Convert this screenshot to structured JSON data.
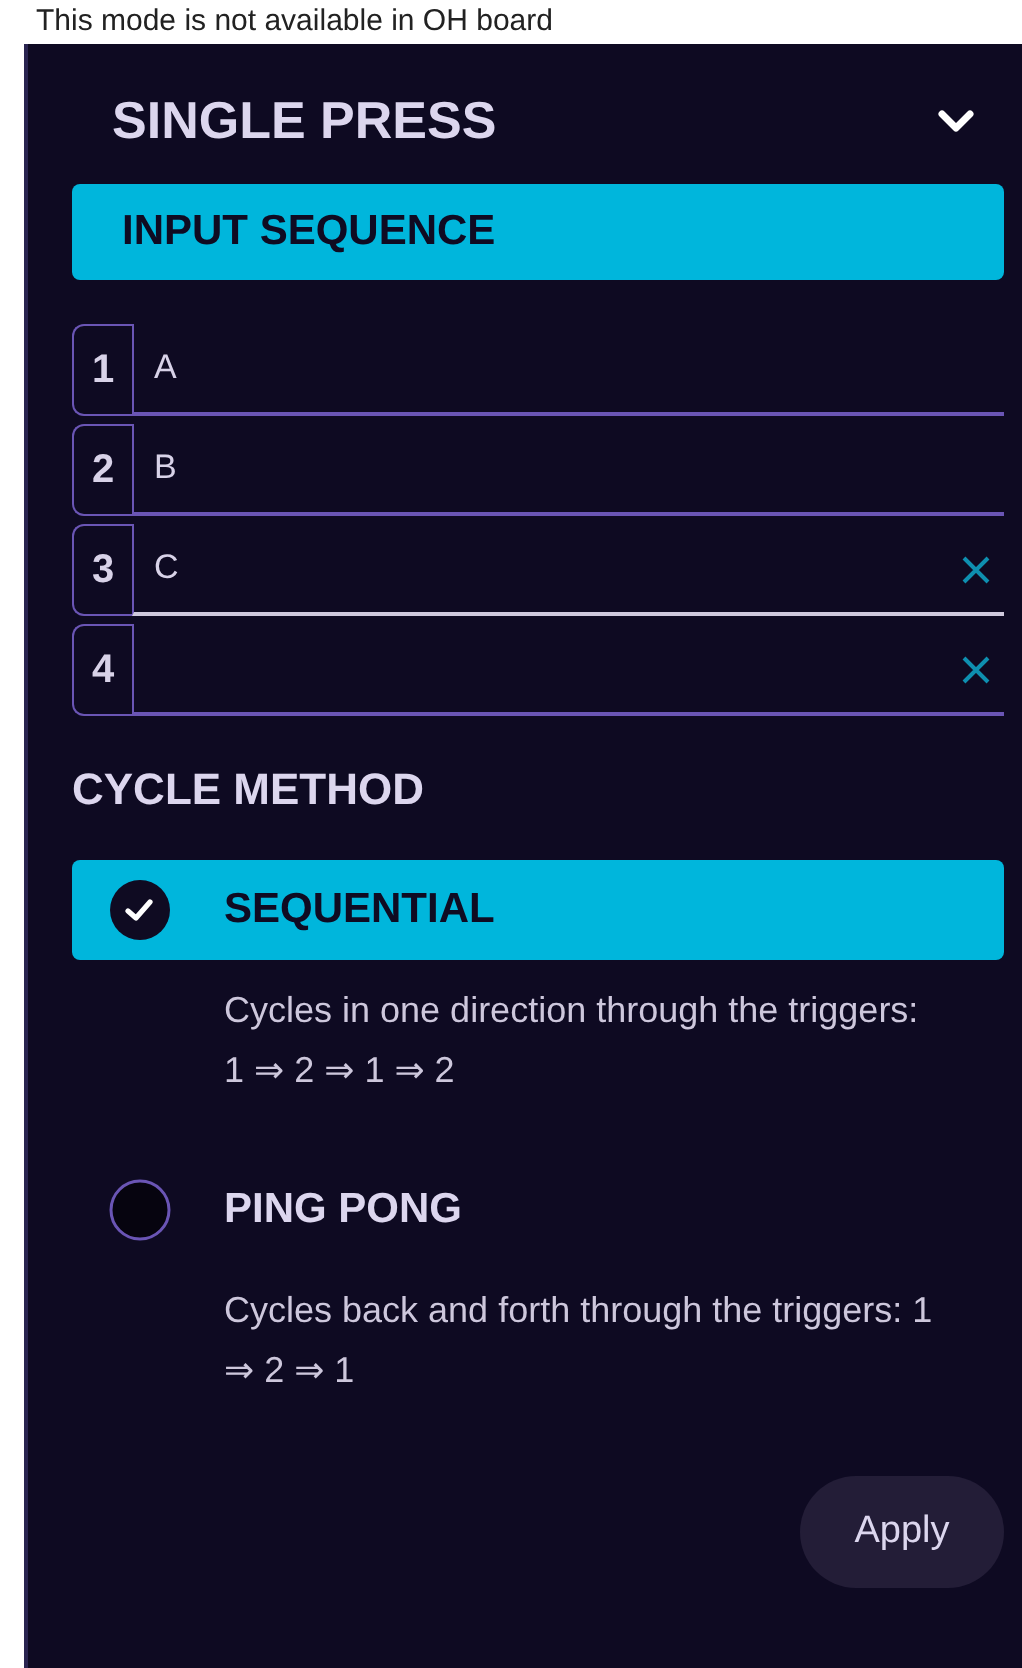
{
  "notice": "This mode is not available in OH board",
  "header": {
    "title": "SINGLE PRESS",
    "expanded": true
  },
  "input_sequence": {
    "title": "INPUT SEQUENCE",
    "rows": [
      {
        "number": "1",
        "value": "A",
        "focused": false,
        "clearable": false
      },
      {
        "number": "2",
        "value": "B",
        "focused": false,
        "clearable": false
      },
      {
        "number": "3",
        "value": "C",
        "focused": true,
        "clearable": true
      },
      {
        "number": "4",
        "value": "",
        "focused": false,
        "clearable": true
      }
    ]
  },
  "cycle_method": {
    "title": "CYCLE METHOD",
    "options": [
      {
        "label": "SEQUENTIAL",
        "description": "Cycles in one direction through the triggers: 1 ⇒ 2 ⇒ 1 ⇒ 2",
        "selected": true
      },
      {
        "label": "PING PONG",
        "description": "Cycles back and forth through the triggers: 1 ⇒ 2 ⇒ 1",
        "selected": false
      }
    ]
  },
  "apply_button": "Apply"
}
